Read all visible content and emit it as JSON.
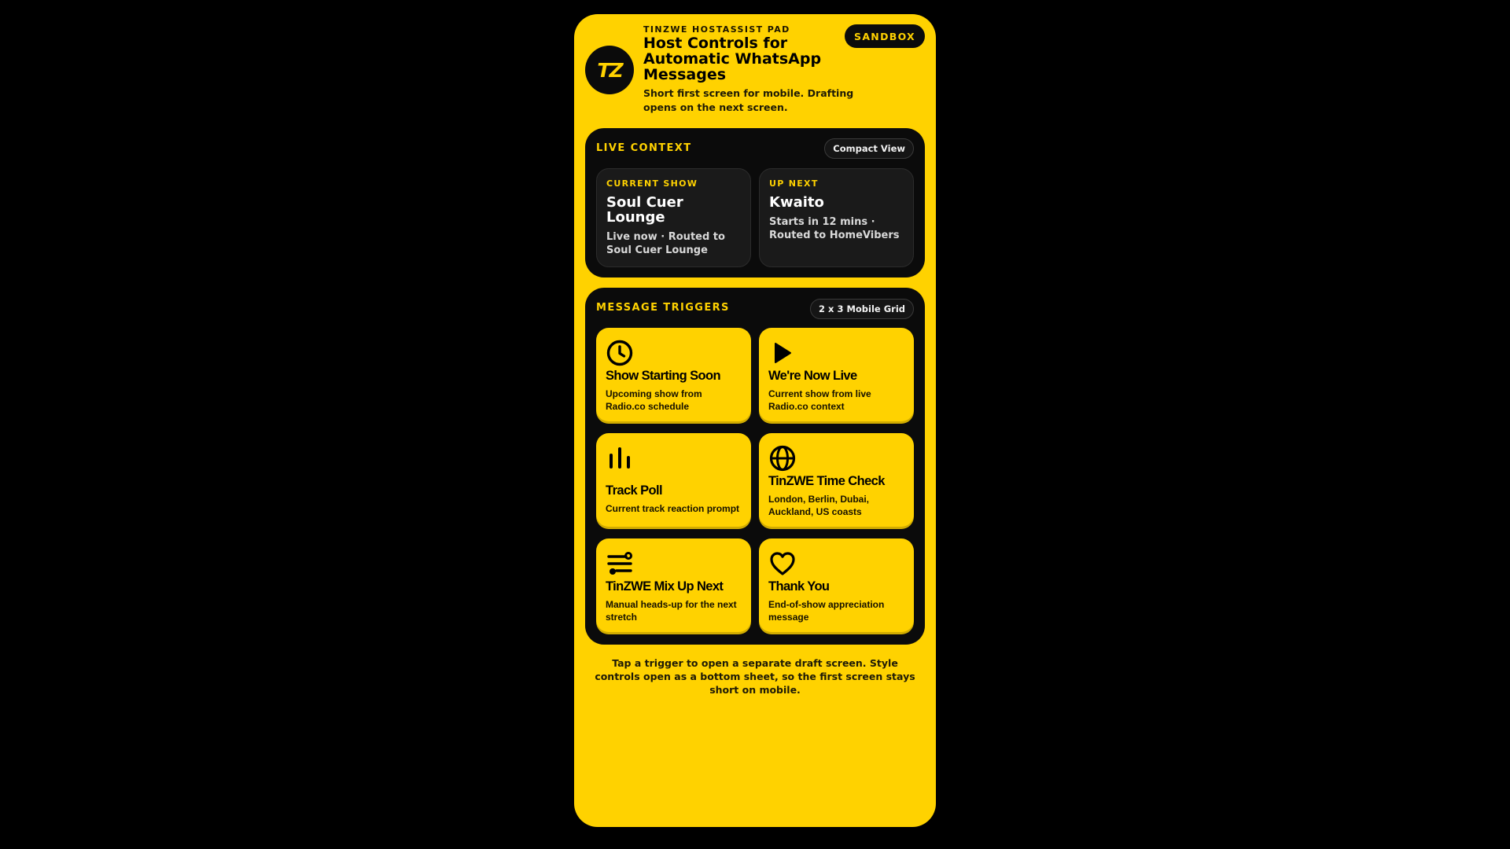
{
  "header": {
    "logo_text": "TZ",
    "eyebrow": "TINZWE HOSTASSIST PAD",
    "title": "Host Controls for Automatic WhatsApp Messages",
    "subtitle": "Short first screen for mobile. Drafting opens on the next screen.",
    "badge": "SANDBOX"
  },
  "live_context": {
    "heading": "LIVE CONTEXT",
    "view_toggle": "Compact View",
    "current": {
      "label": "CURRENT SHOW",
      "title": "Soul Cuer Lounge",
      "description": "Live now · Routed to Soul Cuer Lounge"
    },
    "next": {
      "label": "UP NEXT",
      "title": "Kwaito",
      "description": "Starts in 12 mins · Routed to HomeVibers"
    }
  },
  "triggers": {
    "heading": "MESSAGE TRIGGERS",
    "grid_label": "2 x 3 Mobile Grid",
    "items": [
      {
        "icon": "clock-icon",
        "title": "Show Starting Soon",
        "description": "Upcoming show from Radio.co schedule"
      },
      {
        "icon": "play-icon",
        "title": "We're Now Live",
        "description": "Current show from live Radio.co context"
      },
      {
        "icon": "bar-chart-icon",
        "title": "Track Poll",
        "description": "Current track reaction prompt"
      },
      {
        "icon": "globe-icon",
        "title": "TinZWE Time Check",
        "description": "London, Berlin, Dubai, Auckland, US coasts"
      },
      {
        "icon": "mix-lines-icon",
        "title": "TinZWE Mix Up Next",
        "description": "Manual heads-up for the next stretch"
      },
      {
        "icon": "heart-icon",
        "title": "Thank You",
        "description": "End-of-show appreciation message"
      }
    ]
  },
  "footer": {
    "note": "Tap a trigger to open a separate draft screen. Style controls open as a bottom sheet, so the first screen stays short on mobile."
  },
  "colors": {
    "accent": "#FFD200",
    "panel": "#0B0B0B",
    "card_dark": "#1A1A1A",
    "background": "#000000"
  }
}
